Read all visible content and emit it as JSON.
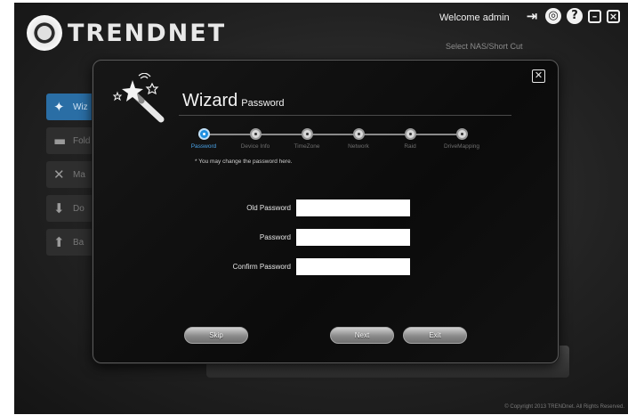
{
  "header": {
    "brand": "TRENDNET",
    "welcome": "Welcome admin",
    "select_nas": "Select NAS/Short Cut",
    "icons": [
      "logout-icon",
      "settings-icon",
      "help-icon",
      "minimize-icon",
      "close-icon"
    ]
  },
  "sidebar": {
    "items": [
      {
        "label": "Wiz",
        "icon": "wizard-icon",
        "active": true
      },
      {
        "label": "Fold",
        "icon": "folder-icon",
        "active": false
      },
      {
        "label": "Ma",
        "icon": "tools-icon",
        "active": false
      },
      {
        "label": "Do",
        "icon": "download-icon",
        "active": false
      },
      {
        "label": "Ba",
        "icon": "backup-icon",
        "active": false
      }
    ]
  },
  "dialog": {
    "title": "Wizard",
    "subtitle": "Password",
    "close_label": "✕",
    "steps": [
      {
        "label": "Password",
        "active": true
      },
      {
        "label": "Device Info",
        "active": false
      },
      {
        "label": "TimeZone",
        "active": false
      },
      {
        "label": "Network",
        "active": false
      },
      {
        "label": "Raid",
        "active": false
      },
      {
        "label": "DriveMapping",
        "active": false
      }
    ],
    "hint": "* You may change the password here.",
    "form": {
      "old_password_label": "Old Password",
      "password_label": "Password",
      "confirm_password_label": "Confirm Password",
      "old_password_value": "",
      "password_value": "",
      "confirm_password_value": ""
    },
    "buttons": {
      "skip": "Skip",
      "next": "Next",
      "exit": "Exit"
    }
  },
  "footer": {
    "copyright": "© Copyright 2013 TRENDnet. All Rights Reserved."
  },
  "colors": {
    "accent": "#1d8fe0",
    "sidebar_active": "#2a6ea5",
    "background": "#222222"
  }
}
